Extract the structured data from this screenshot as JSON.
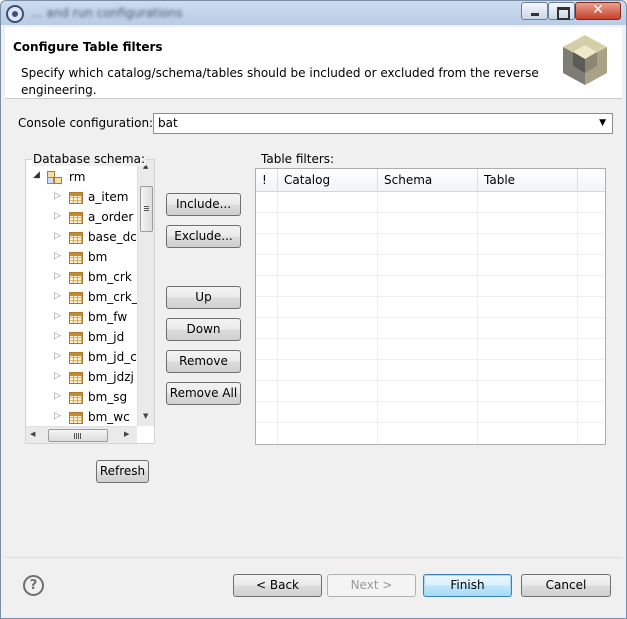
{
  "window": {
    "title": "... and run configurations",
    "close_glyph": "✕"
  },
  "header": {
    "title": "Configure Table filters",
    "description": "Specify which catalog/schema/tables should be included or excluded from the reverse engineering."
  },
  "console": {
    "label": "Console configuration:",
    "value": "bat"
  },
  "schema": {
    "label": "Database schema:",
    "root": "rm",
    "items": [
      "a_item",
      "a_order",
      "base_dc",
      "bm",
      "bm_crk",
      "bm_crk_",
      "bm_fw",
      "bm_jd",
      "bm_jd_c",
      "bm_jdzj",
      "bm_sg",
      "bm_wc"
    ],
    "refresh_label": "Refresh"
  },
  "actions": {
    "include": "Include...",
    "exclude": "Exclude...",
    "up": "Up",
    "down": "Down",
    "remove": "Remove",
    "remove_all": "Remove All"
  },
  "filters": {
    "label": "Table filters:",
    "columns": [
      "!",
      "Catalog",
      "Schema",
      "Table"
    ]
  },
  "footer": {
    "help_glyph": "?",
    "back": "< Back",
    "next": "Next >",
    "finish": "Finish",
    "cancel": "Cancel"
  },
  "icons": {
    "tree_expanded": "◢",
    "tree_collapsed": "▷",
    "dropdown": "▼",
    "scroll_up": "▲",
    "scroll_down": "▼",
    "scroll_left": "◀",
    "scroll_right": "▶"
  },
  "colors": {
    "accent": "#3c7fb1",
    "close": "#c7402b"
  }
}
